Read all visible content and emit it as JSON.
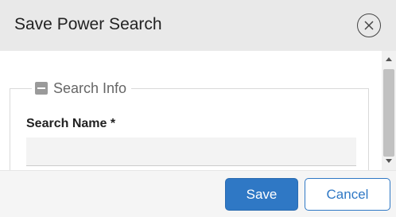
{
  "dialog": {
    "title": "Save Power Search",
    "close_icon": "close-circle-icon"
  },
  "section": {
    "legend": "Search Info",
    "collapse_icon": "minus-square-icon"
  },
  "form": {
    "search_name_label": "Search Name *",
    "search_name_value": "",
    "search_name_placeholder": ""
  },
  "footer": {
    "save_label": "Save",
    "cancel_label": "Cancel"
  },
  "colors": {
    "primary": "#2f78c5",
    "header_bg": "#e9e9e9",
    "footer_bg": "#f5f5f5"
  }
}
